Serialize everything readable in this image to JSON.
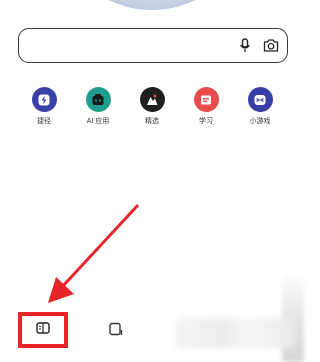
{
  "search": {
    "placeholder": ""
  },
  "apps": [
    {
      "label": "捷径",
      "icon": "lightning-icon",
      "color": "#3b3fa8"
    },
    {
      "label": "AI 应用",
      "icon": "ai-robot-icon",
      "color": "#1f9e8e"
    },
    {
      "label": "精选",
      "icon": "featured-icon",
      "color": "#1f1f1f"
    },
    {
      "label": "学习",
      "icon": "study-icon",
      "color": "#e84b4b"
    },
    {
      "label": "小游戏",
      "icon": "game-icon",
      "color": "#3a3fa8"
    }
  ],
  "colors": {
    "highlight": "#e8242b",
    "arrow": "#e8242b"
  }
}
